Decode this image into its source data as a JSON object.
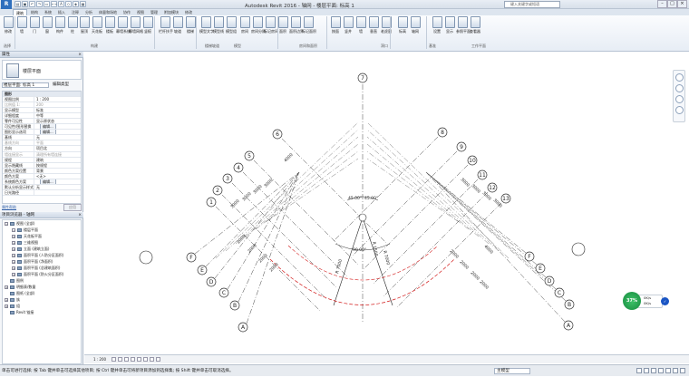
{
  "app": {
    "title": "Autodesk Revit 2016 -  轴网 - 楼层平面: 标高 1",
    "search_placeholder": "键入关键字或短语",
    "logo": "R"
  },
  "tabs": [
    "建筑",
    "结构",
    "系统",
    "插入",
    "注释",
    "分析",
    "体量和场地",
    "协作",
    "视图",
    "管理",
    "附加模块",
    "修改"
  ],
  "active_tab": "建筑",
  "ribbon": {
    "tools": [
      "修改",
      "墙",
      "门",
      "窗",
      "构件",
      "柱",
      "屋顶",
      "天花板",
      "楼板",
      "幕墙系统",
      "幕墙网格",
      "竖梃",
      "栏杆扶手",
      "坡道",
      "楼梯",
      "模型文字",
      "模型线",
      "模型组",
      "房间",
      "房间分隔",
      "标记房间",
      "面积",
      "面积边界",
      "标记面积",
      "按面",
      "竖井",
      "墙",
      "垂直",
      "老虎窗",
      "标高",
      "轴网",
      "设置",
      "显示",
      "参照平面",
      "查看器"
    ],
    "panels": [
      "选择",
      "构建",
      "楼梯坡道",
      "模型",
      "房间和面积",
      "洞口",
      "基准",
      "工作平面"
    ]
  },
  "properties": {
    "title": "属性",
    "type_name": "楼层平面",
    "selector": "楼层平面: 标高 1",
    "edit_type": "编辑类型",
    "rows": [
      {
        "k": "图形",
        "v": "",
        "group": true
      },
      {
        "k": "视图比例",
        "v": "1 : 200"
      },
      {
        "k": "比例值 1:",
        "v": "200",
        "dim": true
      },
      {
        "k": "显示模型",
        "v": "标准"
      },
      {
        "k": "详细程度",
        "v": "中等"
      },
      {
        "k": "零件可见性",
        "v": "显示原状态"
      },
      {
        "k": "可见性/图形替换",
        "v": "编辑..."
      },
      {
        "k": "图形显示选项",
        "v": "编辑..."
      },
      {
        "k": "基线",
        "v": "无"
      },
      {
        "k": "基线方向",
        "v": "平面",
        "dim": true
      },
      {
        "k": "方向",
        "v": "项目北"
      },
      {
        "k": "墙连接显示",
        "v": "清理所有墙连接",
        "dim": true
      },
      {
        "k": "规程",
        "v": "建筑"
      },
      {
        "k": "显示隐藏线",
        "v": "按规程"
      },
      {
        "k": "颜色方案位置",
        "v": "背景"
      },
      {
        "k": "颜色方案",
        "v": "<无>"
      },
      {
        "k": "系统颜色方案",
        "v": "编辑..."
      },
      {
        "k": "默认分析显示样式",
        "v": "无"
      },
      {
        "k": "日光路径",
        "v": ""
      }
    ],
    "help": "属性帮助",
    "apply": "应用"
  },
  "browser": {
    "title": "项目浏览器 - 轴网",
    "items": [
      {
        "label": "视图 (全部)",
        "lvl": 0,
        "exp": "−"
      },
      {
        "label": "楼层平面",
        "lvl": 1,
        "exp": "−"
      },
      {
        "label": "天花板平面",
        "lvl": 1,
        "exp": "+"
      },
      {
        "label": "三维视图",
        "lvl": 1,
        "exp": "+"
      },
      {
        "label": "立面 (建筑立面)",
        "lvl": 1,
        "exp": "+"
      },
      {
        "label": "面积平面 (人防分区面积)",
        "lvl": 1,
        "exp": "+"
      },
      {
        "label": "面积平面 (净面积)",
        "lvl": 1,
        "exp": "+"
      },
      {
        "label": "面积平面 (总建筑面积)",
        "lvl": 1,
        "exp": "+"
      },
      {
        "label": "面积平面 (防火分区面积)",
        "lvl": 1,
        "exp": "+"
      },
      {
        "label": "图例",
        "lvl": 0,
        "exp": ""
      },
      {
        "label": "明细表/数量",
        "lvl": 0,
        "exp": "+"
      },
      {
        "label": "图纸 (全部)",
        "lvl": 0,
        "exp": ""
      },
      {
        "label": "族",
        "lvl": 0,
        "exp": "+"
      },
      {
        "label": "组",
        "lvl": 0,
        "exp": "+"
      },
      {
        "label": "Revit 链接",
        "lvl": 0,
        "exp": ""
      }
    ]
  },
  "status": {
    "text": "单击可进行选择; 按 Tab 键并单击可选择其他项目; 按 Ctrl 键并单击可将新项目添加到选择集; 按 Shift 键并单击可取消选择。",
    "scale": "1 : 200",
    "model": "主模型",
    "filter_count": ":0"
  },
  "perf": {
    "pct": "37%",
    "up": "0K/s",
    "down": "0K/s"
  },
  "grid": {
    "numbers": [
      "1",
      "2",
      "3",
      "4",
      "5",
      "6",
      "7",
      "8",
      "9",
      "10",
      "11",
      "12",
      "13"
    ],
    "letters": [
      "A",
      "B",
      "C",
      "D",
      "E",
      "F"
    ],
    "dims": [
      "3000",
      "3000",
      "3000",
      "3000",
      "4000",
      "3000",
      "3000",
      "3000",
      "3000",
      "4000",
      "2000",
      "2000",
      "2000",
      "2000",
      "2000",
      "2000",
      "2000",
      "2000"
    ],
    "angles": [
      "45.00°",
      "45.00°",
      "90.00°"
    ],
    "radius": [
      "R 1500",
      "R 7000",
      "R 7000"
    ]
  }
}
